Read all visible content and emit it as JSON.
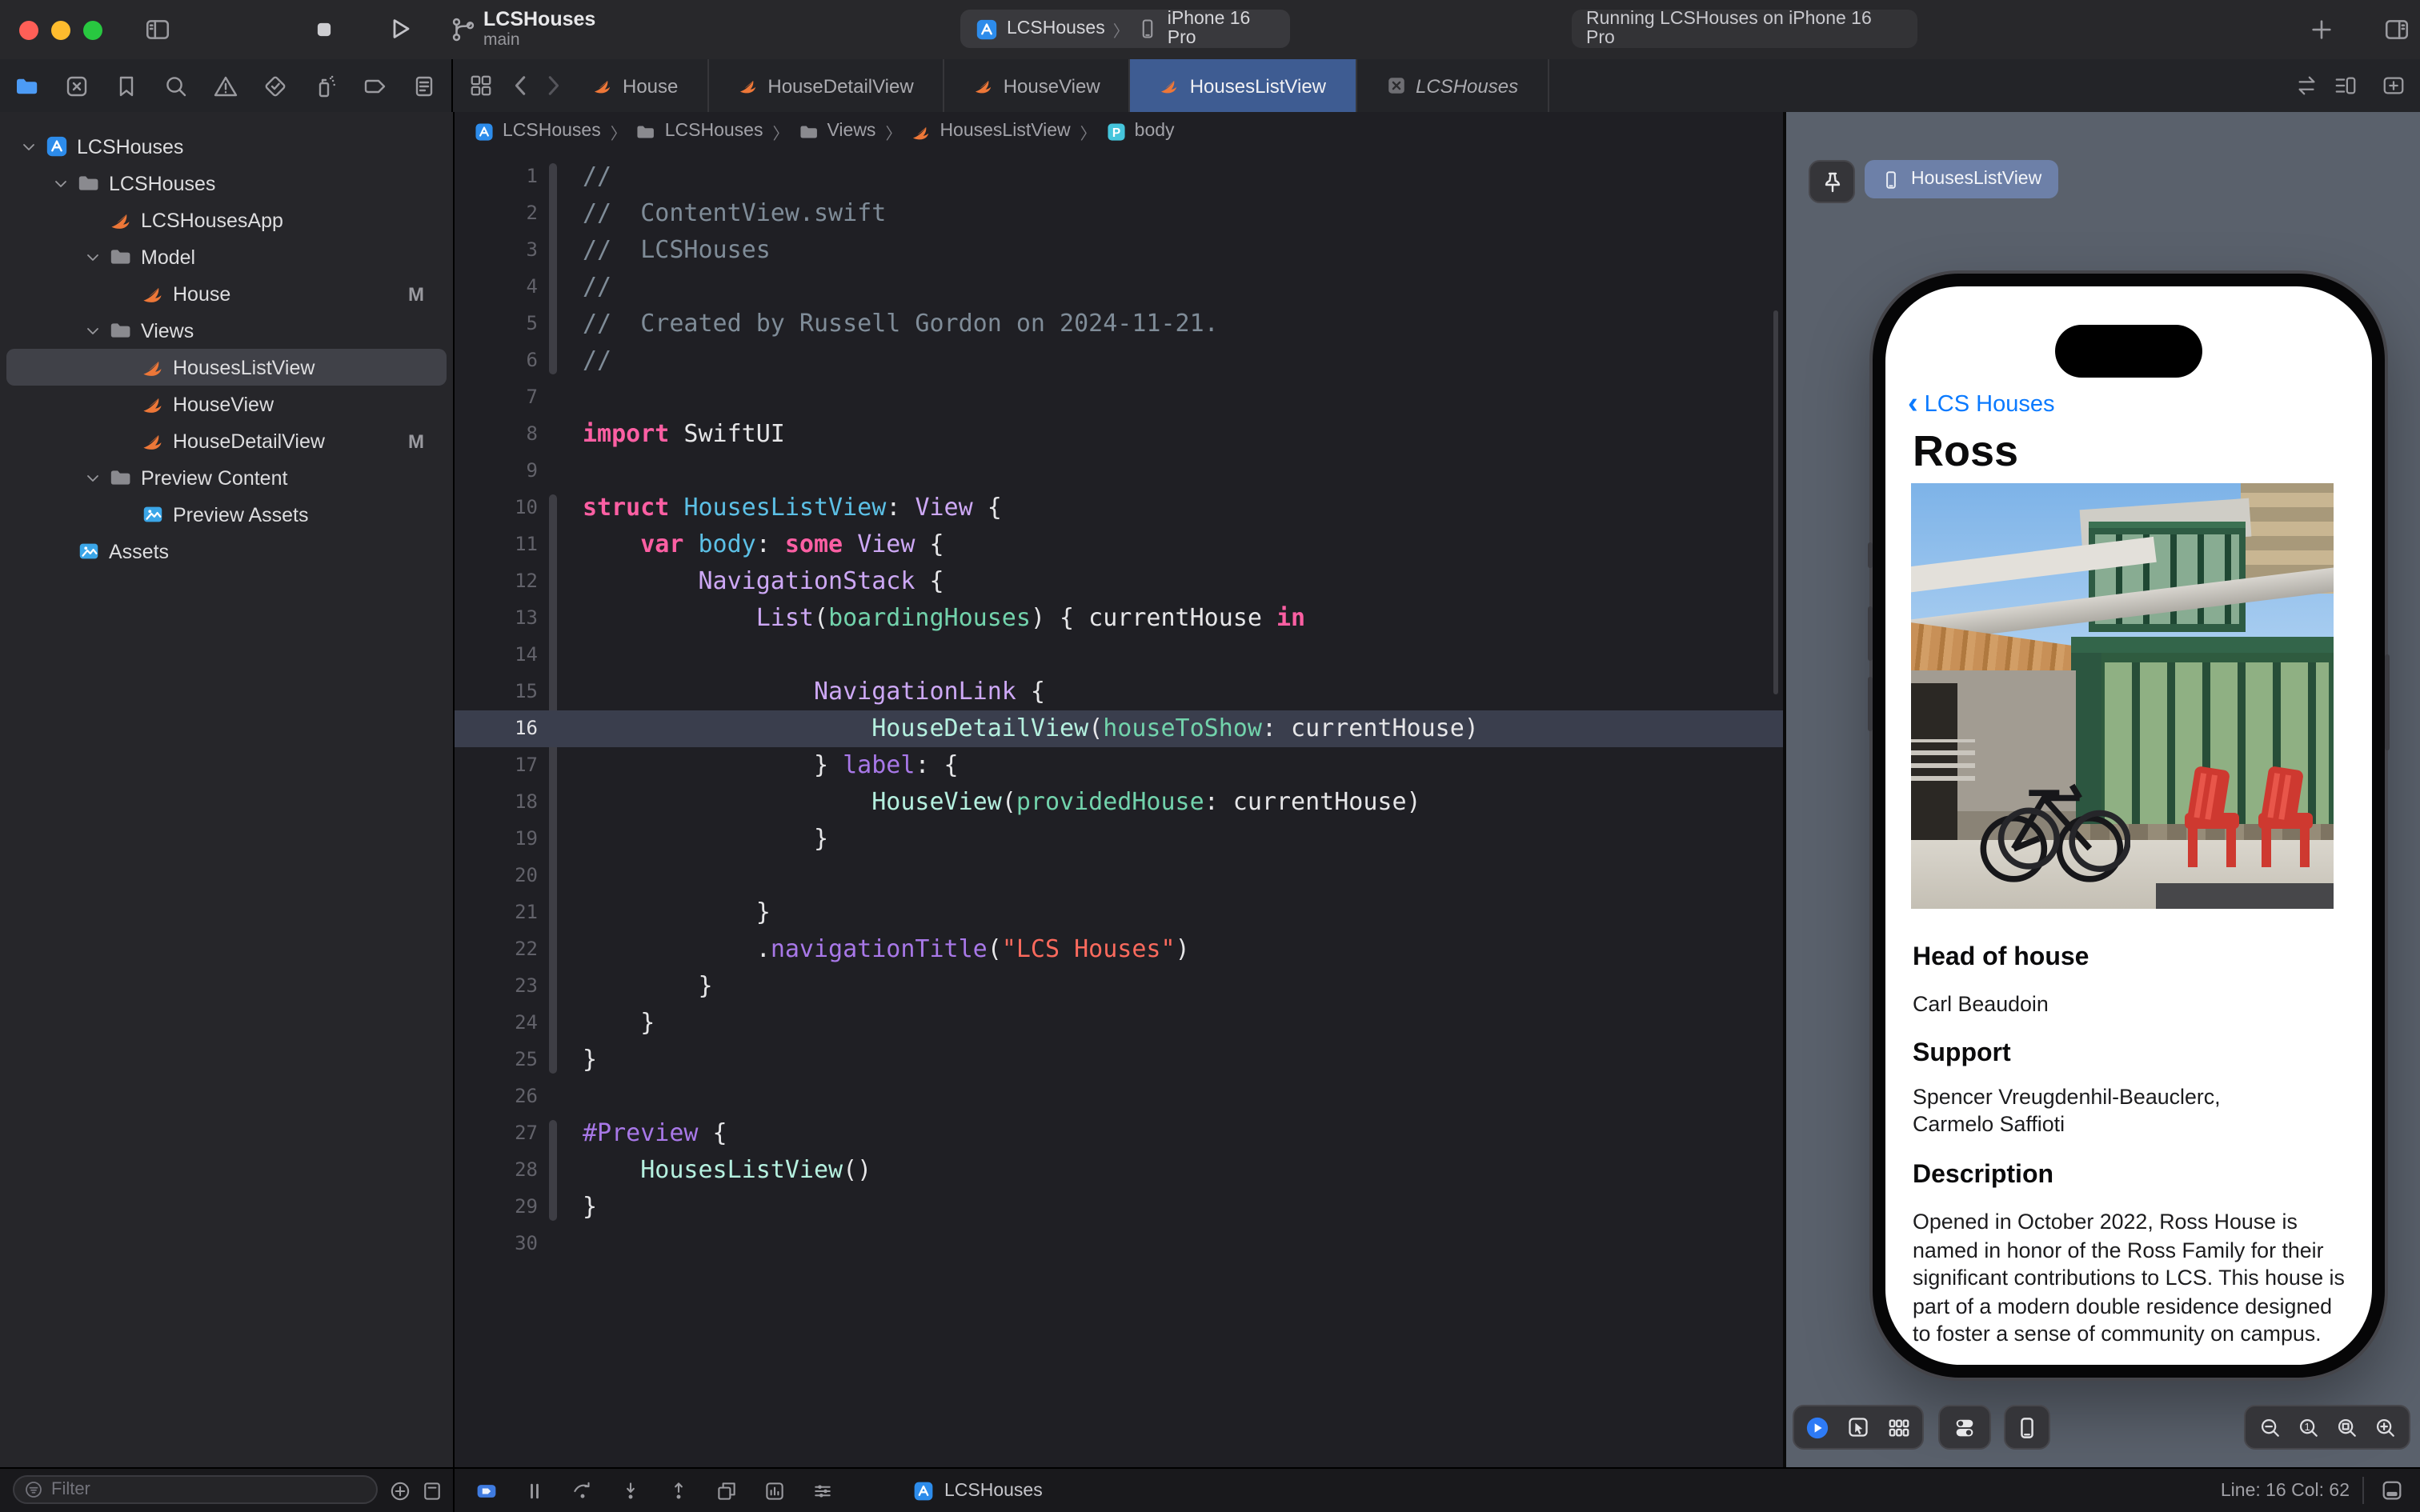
{
  "colors": {
    "accent_tab": "#3E5C92",
    "run_blue": "#2E7BF6",
    "swift_orange": "#ED7738",
    "ios_blue": "#0A7AFF",
    "canvas_gray": "#5A616C",
    "badge_blue": "#6D80A8",
    "traffic": [
      "#FF5F57",
      "#FEBC2E",
      "#28C840"
    ]
  },
  "titlebar": {
    "project": "LCSHouses",
    "branch": "main",
    "scheme_project": "LCSHouses",
    "destination": "iPhone 16 Pro",
    "status": "Running LCSHouses on iPhone 16 Pro",
    "icons": [
      "sidebar-toggle-icon",
      "stop-icon",
      "play-icon",
      "branch-icon",
      "plus-icon",
      "right-panel-icon"
    ]
  },
  "navigator_icons": [
    {
      "name": "project-navigator-icon",
      "active": true
    },
    {
      "name": "changes-navigator-icon",
      "active": false
    },
    {
      "name": "bookmarks-navigator-icon",
      "active": false
    },
    {
      "name": "find-navigator-icon",
      "active": false
    },
    {
      "name": "issues-navigator-icon",
      "active": false
    },
    {
      "name": "tests-navigator-icon",
      "active": false
    },
    {
      "name": "debug-navigator-icon",
      "active": false
    },
    {
      "name": "breakpoints-navigator-icon",
      "active": false
    },
    {
      "name": "reports-navigator-icon",
      "active": false
    }
  ],
  "tabbar": {
    "active_index": 3,
    "tabs": [
      {
        "icon": "swift",
        "label": "House",
        "italic": false
      },
      {
        "icon": "swift",
        "label": "HouseDetailView",
        "italic": false
      },
      {
        "icon": "swift",
        "label": "HouseView",
        "italic": false
      },
      {
        "icon": "swift",
        "label": "HousesListView",
        "italic": false
      },
      {
        "icon": "xproj",
        "label": "LCSHouses",
        "italic": true
      }
    ]
  },
  "breadcrumb": [
    {
      "icon": "app",
      "label": "LCSHouses"
    },
    {
      "icon": "folder",
      "label": "LCSHouses"
    },
    {
      "icon": "folder",
      "label": "Views"
    },
    {
      "icon": "swift",
      "label": "HousesListView"
    },
    {
      "icon": "pbadge",
      "label": "body"
    }
  ],
  "sidebar": {
    "items": [
      {
        "depth": 0,
        "chevron": true,
        "icon": "app",
        "label": "LCSHouses",
        "selected": false,
        "badge": ""
      },
      {
        "depth": 1,
        "chevron": true,
        "icon": "folder",
        "label": "LCSHouses",
        "selected": false,
        "badge": ""
      },
      {
        "depth": 2,
        "chevron": false,
        "icon": "swift",
        "label": "LCSHousesApp",
        "selected": false,
        "badge": ""
      },
      {
        "depth": 2,
        "chevron": true,
        "icon": "folder",
        "label": "Model",
        "selected": false,
        "badge": ""
      },
      {
        "depth": 3,
        "chevron": false,
        "icon": "swift",
        "label": "House",
        "selected": false,
        "badge": "M"
      },
      {
        "depth": 2,
        "chevron": true,
        "icon": "folder",
        "label": "Views",
        "selected": false,
        "badge": ""
      },
      {
        "depth": 3,
        "chevron": false,
        "icon": "swift",
        "label": "HousesListView",
        "selected": true,
        "badge": ""
      },
      {
        "depth": 3,
        "chevron": false,
        "icon": "swift",
        "label": "HouseView",
        "selected": false,
        "badge": ""
      },
      {
        "depth": 3,
        "chevron": false,
        "icon": "swift",
        "label": "HouseDetailView",
        "selected": false,
        "badge": "M"
      },
      {
        "depth": 2,
        "chevron": true,
        "icon": "folder",
        "label": "Preview Content",
        "selected": false,
        "badge": ""
      },
      {
        "depth": 3,
        "chevron": false,
        "icon": "assets",
        "label": "Preview Assets",
        "selected": false,
        "badge": ""
      },
      {
        "depth": 1,
        "chevron": false,
        "icon": "assets",
        "label": "Assets",
        "selected": false,
        "badge": ""
      }
    ]
  },
  "editor": {
    "active_line": 16,
    "ribbons": [
      [
        1,
        6
      ],
      [
        10,
        25
      ],
      [
        27,
        29
      ]
    ],
    "lines": [
      [
        [
          "cmt",
          "//"
        ]
      ],
      [
        [
          "cmt",
          "//  ContentView.swift"
        ]
      ],
      [
        [
          "cmt",
          "//  LCSHouses"
        ]
      ],
      [
        [
          "cmt",
          "//"
        ]
      ],
      [
        [
          "cmt",
          "//  Created by Russell Gordon on 2024-11-21."
        ]
      ],
      [
        [
          "cmt",
          "//"
        ]
      ],
      [],
      [
        [
          "kw",
          "import"
        ],
        [
          "pln",
          " SwiftUI"
        ]
      ],
      [],
      [
        [
          "kw",
          "struct"
        ],
        [
          "pln",
          " "
        ],
        [
          "decl",
          "HousesListView"
        ],
        [
          "pln",
          ": "
        ],
        [
          "type",
          "View"
        ],
        [
          "pln",
          " {"
        ]
      ],
      [
        [
          "pln",
          "    "
        ],
        [
          "kw",
          "var"
        ],
        [
          "pln",
          " "
        ],
        [
          "decl",
          "body"
        ],
        [
          "pln",
          ": "
        ],
        [
          "kw",
          "some"
        ],
        [
          "pln",
          " "
        ],
        [
          "type",
          "View"
        ],
        [
          "pln",
          " {"
        ]
      ],
      [
        [
          "pln",
          "        "
        ],
        [
          "type",
          "NavigationStack"
        ],
        [
          "pln",
          " {"
        ]
      ],
      [
        [
          "pln",
          "            "
        ],
        [
          "type",
          "List"
        ],
        [
          "pln",
          "("
        ],
        [
          "prop",
          "boardingHouses"
        ],
        [
          "pln",
          ") { currentHouse "
        ],
        [
          "kw",
          "in"
        ]
      ],
      [],
      [
        [
          "pln",
          "                "
        ],
        [
          "type",
          "NavigationLink"
        ],
        [
          "pln",
          " {"
        ]
      ],
      [
        [
          "pln",
          "                    "
        ],
        [
          "proj",
          "HouseDetailView"
        ],
        [
          "pln",
          "("
        ],
        [
          "prop",
          "houseToShow"
        ],
        [
          "pln",
          ": currentHouse)"
        ]
      ],
      [
        [
          "pln",
          "                } "
        ],
        [
          "fn",
          "label"
        ],
        [
          "pln",
          ": {"
        ]
      ],
      [
        [
          "pln",
          "                    "
        ],
        [
          "proj",
          "HouseView"
        ],
        [
          "pln",
          "("
        ],
        [
          "prop",
          "providedHouse"
        ],
        [
          "pln",
          ": currentHouse)"
        ]
      ],
      [
        [
          "pln",
          "                }"
        ]
      ],
      [],
      [
        [
          "pln",
          "            }"
        ]
      ],
      [
        [
          "pln",
          "            ."
        ],
        [
          "fn",
          "navigationTitle"
        ],
        [
          "pln",
          "("
        ],
        [
          "str",
          "\"LCS Houses\""
        ],
        [
          "pln",
          ")"
        ]
      ],
      [
        [
          "pln",
          "        }"
        ]
      ],
      [
        [
          "pln",
          "    }"
        ]
      ],
      [
        [
          "pln",
          "}"
        ]
      ],
      [],
      [
        [
          "fn",
          "#Preview"
        ],
        [
          "pln",
          " {"
        ]
      ],
      [
        [
          "pln",
          "    "
        ],
        [
          "proj",
          "HousesListView"
        ],
        [
          "pln",
          "()"
        ]
      ],
      [
        [
          "pln",
          "}"
        ]
      ],
      []
    ]
  },
  "canvas": {
    "preview_badge": "HousesListView",
    "control_icons": [
      "live-preview-icon",
      "selectable-mode-icon",
      "variants-icon",
      "device-settings-icon",
      "device-icon"
    ],
    "zoom_icons": [
      "zoom-out-icon",
      "zoom-100-icon",
      "zoom-fit-icon",
      "zoom-in-icon"
    ]
  },
  "phone": {
    "back_label": "LCS Houses",
    "title": "Ross",
    "sections": [
      {
        "heading": "Head of house",
        "lines": [
          "Carl Beaudoin"
        ]
      },
      {
        "heading": "Support",
        "lines": [
          "Spencer Vreugdenhil-Beauclerc,",
          "Carmelo Saffioti"
        ]
      },
      {
        "heading": "Description",
        "lines": [
          "Opened in October 2022, Ross House is named in honor of the Ross Family for their significant contributions to LCS. This house is part of a modern double residence designed to foster a sense of community on campus."
        ]
      }
    ]
  },
  "bottombar": {
    "filter_placeholder": "Filter",
    "app_label": "LCSHouses",
    "line_col": "Line: 16  Col: 62",
    "debug_icons": [
      "breakpoints-toggle-icon",
      "pause-icon",
      "step-over-icon",
      "step-in-icon",
      "step-out-icon",
      "view-hierarchy-icon",
      "memory-graph-icon",
      "environment-overrides-icon"
    ]
  }
}
